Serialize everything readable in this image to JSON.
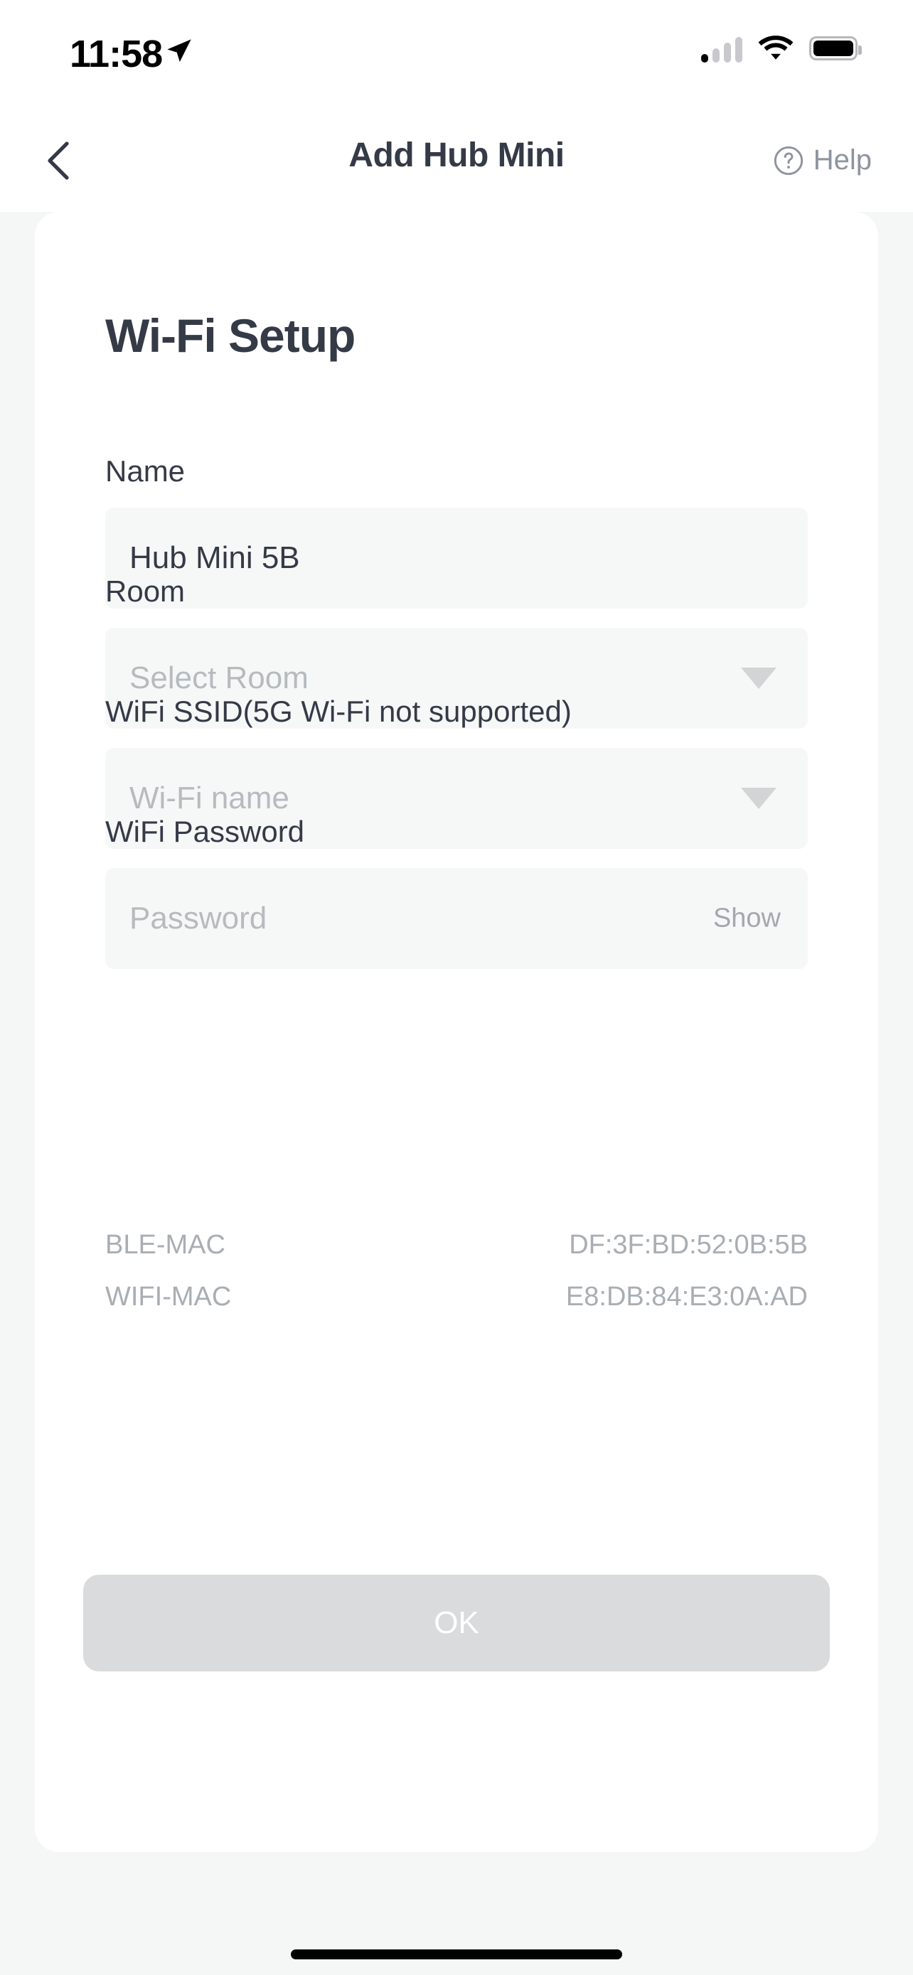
{
  "status_bar": {
    "time": "11:58",
    "location_icon": "location-arrow-icon",
    "cellular_icon": "cellular-signal-icon",
    "cellular_bars_filled": 1,
    "cellular_bars_total": 4,
    "wifi_icon": "wifi-icon",
    "battery_icon": "battery-full-icon"
  },
  "header": {
    "back_icon": "chevron-left-icon",
    "title": "Add Hub Mini",
    "help_icon": "question-circle-icon",
    "help_label": "Help"
  },
  "card": {
    "title": "Wi-Fi Setup",
    "fields": {
      "name": {
        "label": "Name",
        "value": "Hub Mini 5B",
        "placeholder": "Name"
      },
      "room": {
        "label": "Room",
        "value": "",
        "placeholder": "Select Room",
        "caret_icon": "caret-down-icon"
      },
      "ssid": {
        "label": "WiFi SSID(5G Wi-Fi not supported)",
        "value": "",
        "placeholder": "Wi-Fi name",
        "caret_icon": "caret-down-icon"
      },
      "password": {
        "label": "WiFi Password",
        "value": "",
        "placeholder": "Password",
        "show_label": "Show"
      }
    },
    "info_rows": [
      {
        "label": "BLE-MAC",
        "value": "DF:3F:BD:52:0B:5B"
      },
      {
        "label": "WIFI-MAC",
        "value": "E8:DB:84:E3:0A:AD"
      }
    ],
    "submit_label": "OK"
  },
  "colors": {
    "page_background": "#f5f7f7",
    "card_background": "#ffffff",
    "text_primary": "#353a47",
    "text_placeholder": "#b6bbbe",
    "text_muted": "#a9aeb3",
    "input_background": "#f6f8f8",
    "button_disabled": "#d9dbdc",
    "button_text": "#ffffff"
  }
}
